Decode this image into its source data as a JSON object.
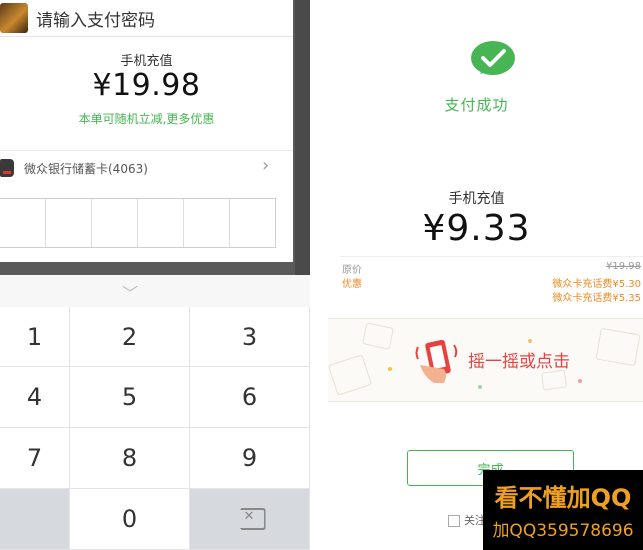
{
  "left": {
    "dialog": {
      "title": "请输入支付密码",
      "amount_label": "手机充值",
      "amount": "¥19.98",
      "promo": "本单可随机立减,更多优惠",
      "card": "微众银行储蓄卡(4063)",
      "chevron": "›",
      "password_cells": 6
    },
    "keyboard": {
      "collapse_glyph": "﹀",
      "keys": [
        "1",
        "2",
        "3",
        "4",
        "5",
        "6",
        "7",
        "8",
        "9",
        "",
        "0",
        ""
      ],
      "delete_icon": "backspace-icon"
    }
  },
  "right": {
    "success_text": "支付成功",
    "label": "手机充值",
    "amount": "¥9.33",
    "detail": {
      "original_label": "原价",
      "original_value": "¥19.98",
      "promo_label": "优惠",
      "promo_1": "微众卡充话费¥5.30",
      "promo_2": "微众卡充话费¥5.35"
    },
    "banner_text": "摇一摇或点击",
    "done_button": "完成",
    "follow_text": "关注"
  },
  "watermark": {
    "line1": "看不懂加QQ",
    "line2": "加QQ359578696"
  },
  "colors": {
    "wechat_green": "#47b553",
    "promo_orange": "#f08a24",
    "banner_red": "#e64340",
    "keyboard_gray": "#d6d9de",
    "overlay": "#5a5a5a"
  }
}
